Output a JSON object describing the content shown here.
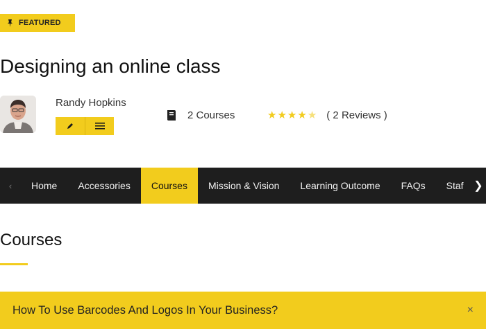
{
  "badge": {
    "label": "FEATURED",
    "icon": "pin-icon"
  },
  "page": {
    "title": "Designing an online class"
  },
  "author": {
    "name": "Randy Hopkins",
    "courses_label": "2 Courses",
    "rating": {
      "stars": 5,
      "reviews_label": "( 2 Reviews )"
    }
  },
  "nav": {
    "tabs": [
      {
        "label": "Home"
      },
      {
        "label": "Accessories"
      },
      {
        "label": "Courses",
        "active": true
      },
      {
        "label": "Mission & Vision"
      },
      {
        "label": "Learning Outcome"
      },
      {
        "label": "FAQs"
      },
      {
        "label": "Staf"
      }
    ]
  },
  "section": {
    "title": "Courses"
  },
  "accordion": {
    "title": "How To Use Barcodes And Logos In Your Business?",
    "toggle": "×"
  },
  "colors": {
    "accent": "#f2cc1d",
    "nav_bg": "#1e1e1e"
  }
}
